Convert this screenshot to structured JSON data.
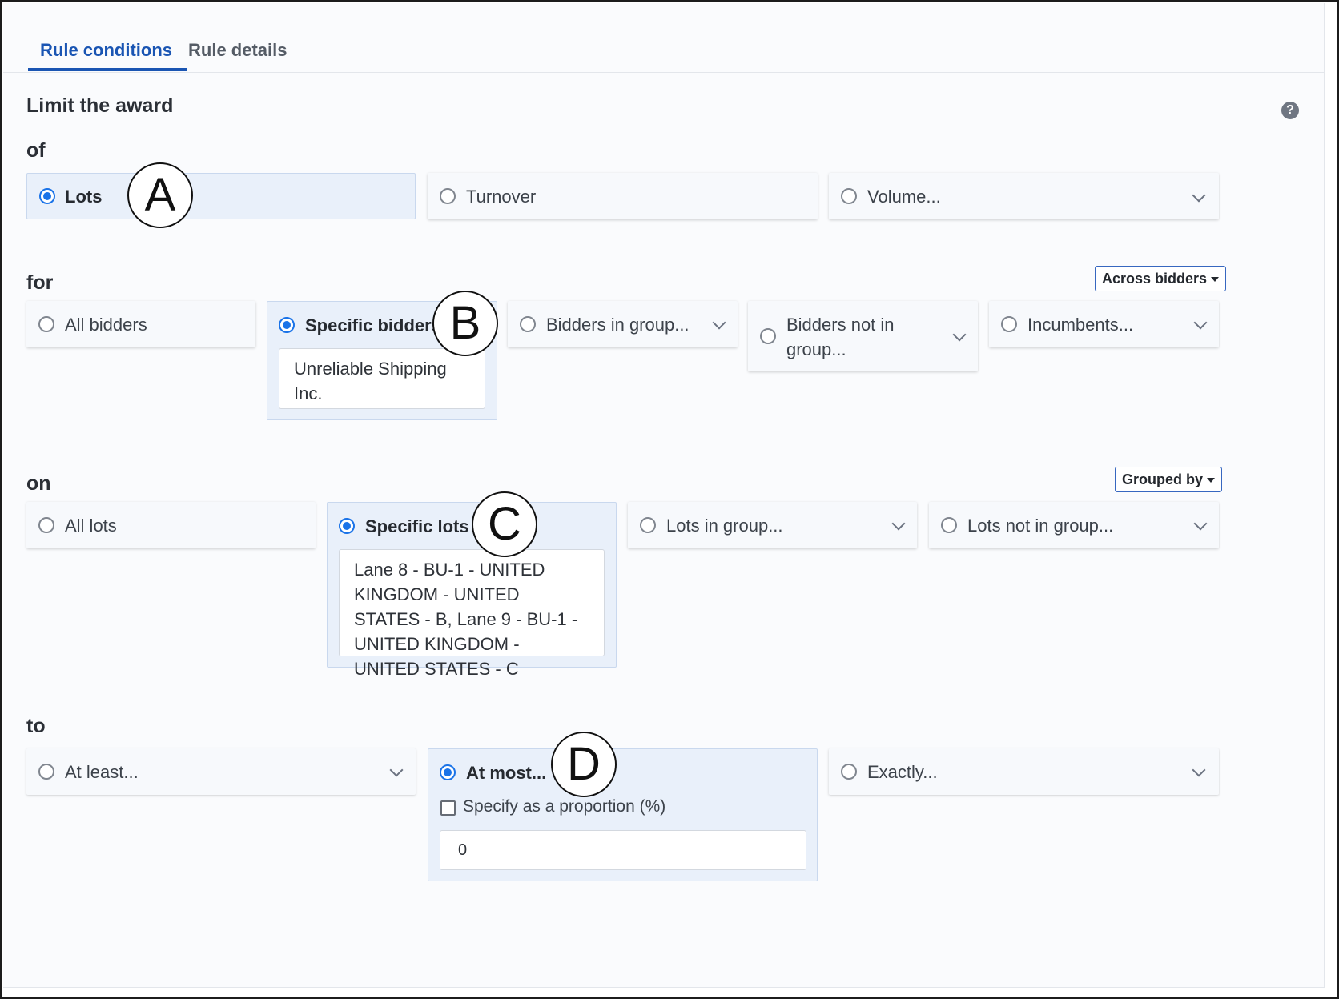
{
  "tabs": [
    {
      "label": "Rule conditions",
      "active": true
    },
    {
      "label": "Rule details",
      "active": false
    }
  ],
  "title": "Limit the award",
  "help_icon": "question-circle-icon",
  "sections": {
    "of": {
      "heading": "of",
      "options": [
        {
          "label": "Lots",
          "selected": true
        },
        {
          "label": "Turnover",
          "selected": false
        },
        {
          "label": "Volume...",
          "selected": false,
          "dropdown": true
        }
      ]
    },
    "for": {
      "heading": "for",
      "mode_button": "Across bidders",
      "options": [
        {
          "label": "All bidders",
          "selected": false
        },
        {
          "label": "Specific bidders...",
          "selected": true,
          "value": "Unreliable Shipping Inc."
        },
        {
          "label": "Bidders in group...",
          "selected": false,
          "dropdown": true
        },
        {
          "label": "Bidders not in group...",
          "selected": false,
          "dropdown": true
        },
        {
          "label": "Incumbents...",
          "selected": false,
          "dropdown": true
        }
      ]
    },
    "on": {
      "heading": "on",
      "mode_button": "Grouped by",
      "options": [
        {
          "label": "All lots",
          "selected": false
        },
        {
          "label": "Specific lots",
          "selected": true,
          "value": "Lane 8 - BU-1 - UNITED KINGDOM - UNITED STATES - B, Lane 9 - BU-1 - UNITED KINGDOM - UNITED STATES - C"
        },
        {
          "label": "Lots in group...",
          "selected": false,
          "dropdown": true
        },
        {
          "label": "Lots not in group...",
          "selected": false,
          "dropdown": true
        }
      ]
    },
    "to": {
      "heading": "to",
      "options": [
        {
          "label": "At least...",
          "selected": false,
          "dropdown": true
        },
        {
          "label": "At most...",
          "selected": true,
          "checkbox_label": "Specify as a proportion (%)",
          "checkbox_checked": false,
          "value": "0"
        },
        {
          "label": "Exactly...",
          "selected": false,
          "dropdown": true
        }
      ]
    }
  },
  "markers": [
    "A",
    "B",
    "C",
    "D"
  ],
  "colors": {
    "accent": "#1a55b3",
    "radio": "#1a73e8",
    "selected_bg": "#e9f0fa"
  }
}
